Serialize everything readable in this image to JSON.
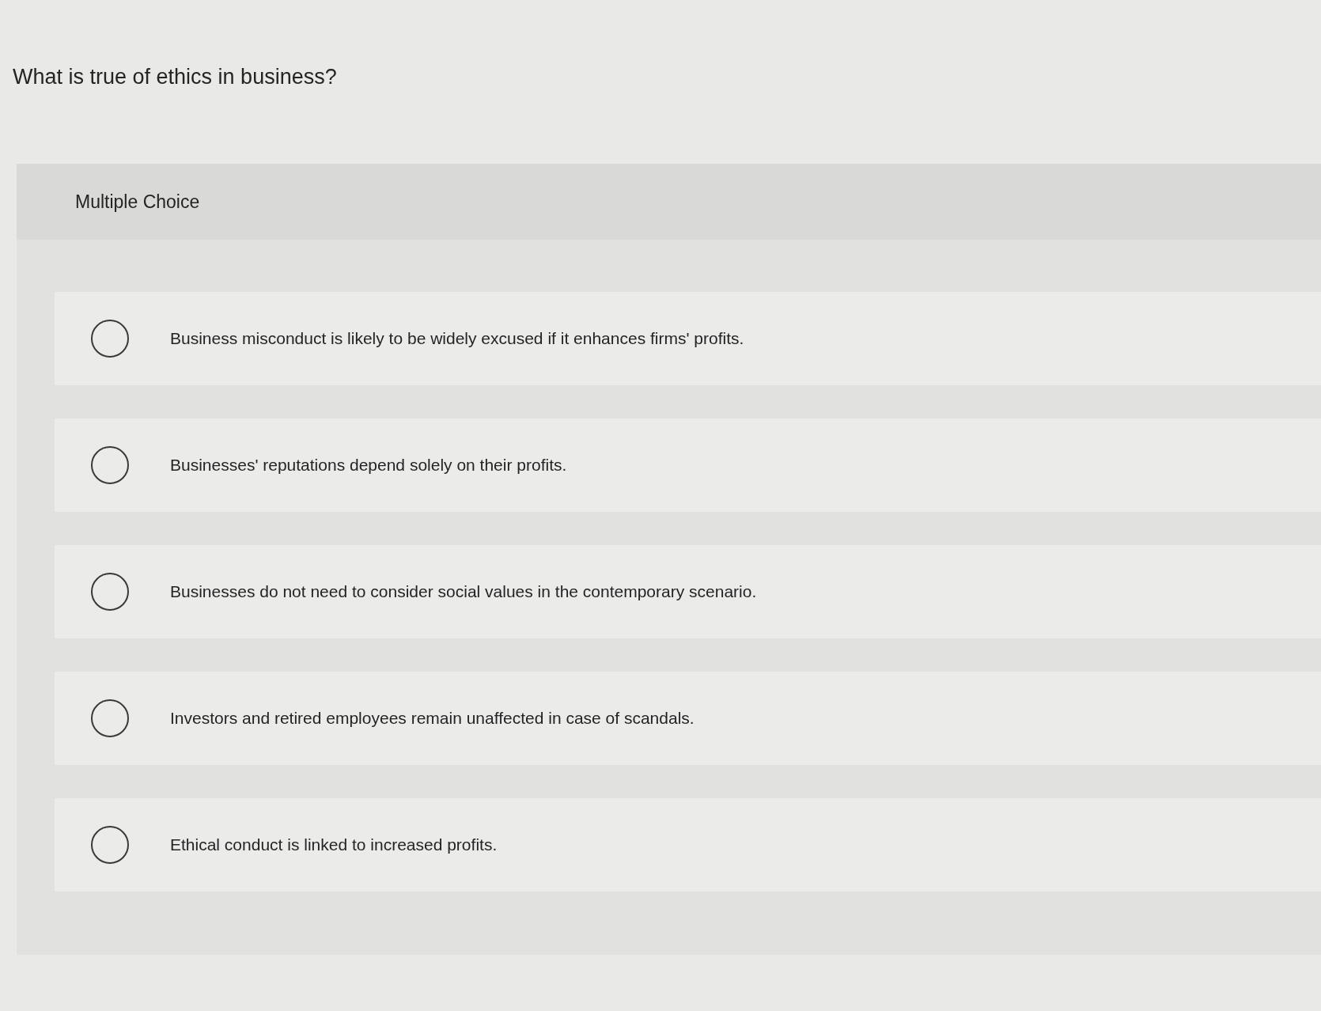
{
  "question": "What is true of ethics in business?",
  "panel": {
    "heading": "Multiple Choice"
  },
  "options": [
    {
      "label": "Business misconduct is likely to be widely excused if it enhances firms' profits.",
      "selected": false
    },
    {
      "label": "Businesses' reputations depend solely on their profits.",
      "selected": false
    },
    {
      "label": "Businesses do not need to consider social values in the contemporary scenario.",
      "selected": false
    },
    {
      "label": "Investors and retired employees remain unaffected in case of scandals.",
      "selected": false
    },
    {
      "label": "Ethical conduct is linked to increased profits.",
      "selected": false
    }
  ]
}
